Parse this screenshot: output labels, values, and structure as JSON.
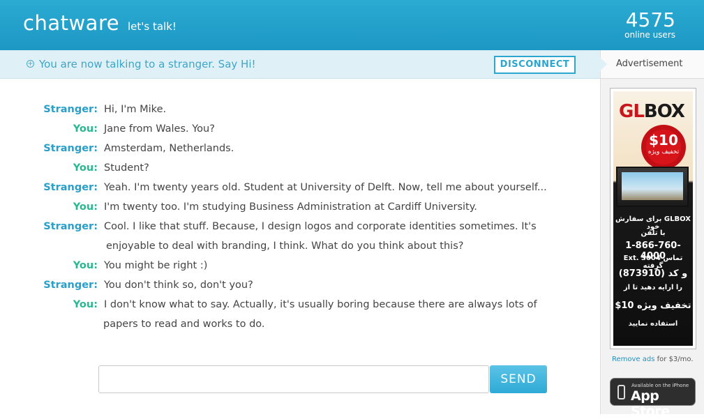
{
  "header": {
    "logo": "chatware",
    "tagline": "let's talk!",
    "users_count": "4575",
    "users_label": "online users"
  },
  "status": {
    "text": "You are now talking to a stranger. Say Hi!",
    "disconnect_label": "DISCONNECT"
  },
  "sidebar": {
    "ad_label": "Advertisement",
    "remove_ads_link": "Remove ads",
    "remove_ads_suffix": "for $3/mo.",
    "appstore_small": "Available on the iPhone",
    "appstore_big": "App Store",
    "ad": {
      "brand_a": "GL",
      "brand_b": "BOX",
      "price": "$10",
      "price_sub": "تخفیف ویژه",
      "order_line": "برای سفارش GLBOX خود",
      "phone_intro": "با تلفن",
      "phone": "1-866-760-4000",
      "ext": "Ext. 3004 تماس گرفته",
      "code": "و کد (873910)",
      "code_line": "را ارایه دهید تا از",
      "discount": "$10 تخفیف ویژه",
      "use": "استفاده نمایید"
    }
  },
  "messages": [
    {
      "who": "Stranger:",
      "type": "stranger",
      "lines": [
        "Hi, I'm Mike."
      ]
    },
    {
      "who": "You:",
      "type": "you",
      "lines": [
        "Jane from Wales. You?"
      ]
    },
    {
      "who": "Stranger:",
      "type": "stranger",
      "lines": [
        "Amsterdam, Netherlands."
      ]
    },
    {
      "who": "You:",
      "type": "you",
      "lines": [
        "Student?"
      ]
    },
    {
      "who": "Stranger:",
      "type": "stranger",
      "lines": [
        "Yeah. I'm twenty years old. Student at University of Delft. Now, tell me about yourself..."
      ]
    },
    {
      "who": "You:",
      "type": "you",
      "lines": [
        "I'm twenty too. I'm studying Business Administration at Cardiff University."
      ]
    },
    {
      "who": "Stranger:",
      "type": "stranger",
      "lines": [
        "Cool. I like that stuff. Because, I design logos and corporate identities sometimes. It's",
        "enjoyable to deal with branding, I think. What do you think about this?"
      ]
    },
    {
      "who": "You:",
      "type": "you",
      "lines": [
        "You might be right :)"
      ]
    },
    {
      "who": "Stranger:",
      "type": "stranger",
      "lines": [
        "You don't think so, don't you?"
      ]
    },
    {
      "who": "You:",
      "type": "you",
      "lines": [
        "I don't know what to say. Actually, it's usually boring because there are always lots of",
        "papers to read and works to do."
      ]
    }
  ],
  "composer": {
    "value": "",
    "placeholder": "",
    "send_label": "SEND"
  }
}
